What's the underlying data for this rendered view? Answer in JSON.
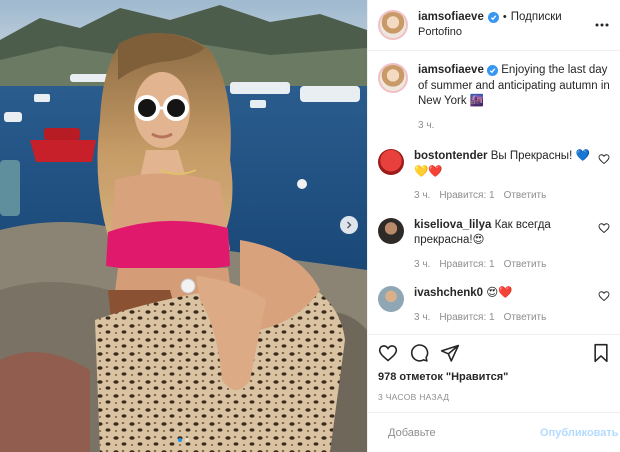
{
  "header": {
    "username": "iamsofiaeve",
    "separator": "•",
    "follow_label": "Подписки",
    "location": "Portofino"
  },
  "caption": {
    "username": "iamsofiaeve",
    "text": "Enjoying the last day of summer and anticipating autumn in New York 🌆",
    "time": "3 ч."
  },
  "comments": [
    {
      "username": "bostontender",
      "text": "Вы Прекрасны! 💙💛❤️",
      "time": "3 ч.",
      "likes": "Нравится: 1",
      "reply": "Ответить"
    },
    {
      "username": "kiseliova_lilya",
      "text": "Как всегда прекрасна!😍",
      "time": "3 ч.",
      "likes": "Нравится: 1",
      "reply": "Ответить"
    },
    {
      "username": "ivashchenk0",
      "text": "😍❤️",
      "time": "3 ч.",
      "likes": "Нравится: 1",
      "reply": "Ответить"
    }
  ],
  "likes_text": "978 отметок \"Нравится\"",
  "time_ago": "3 ЧАСОВ НАЗАД",
  "add_comment": {
    "placeholder": "Добавьте",
    "post_label": "Опубликовать"
  },
  "carousel": {
    "slides": 2,
    "active_index": 1
  },
  "colors": {
    "verified": "#3897f0",
    "carousel_active": "#1a96f0",
    "post_button": "#b3dbff",
    "muted": "#8e8e8e"
  }
}
